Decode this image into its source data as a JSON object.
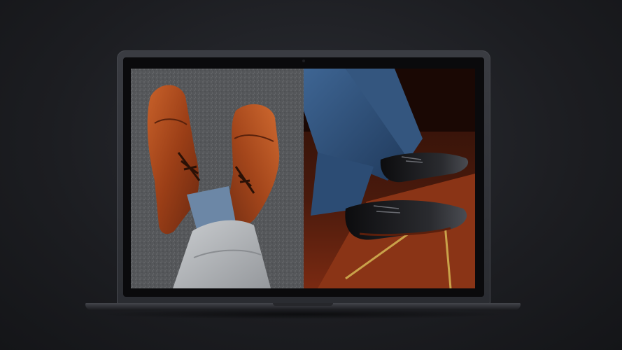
{
  "scene": {
    "subject": "laptop-mockup",
    "screen_content": [
      "brown-brogue-oxfords-photo",
      "black-cap-toe-oxfords-photo"
    ]
  },
  "colors": {
    "background": "#1c1d21",
    "laptop_body": "#2f3136",
    "shoe_brown": "#a84a1f",
    "shoe_black": "#141416",
    "trouser_grey": "#b9bcbf",
    "trouser_blue": "#2e4f7a"
  }
}
